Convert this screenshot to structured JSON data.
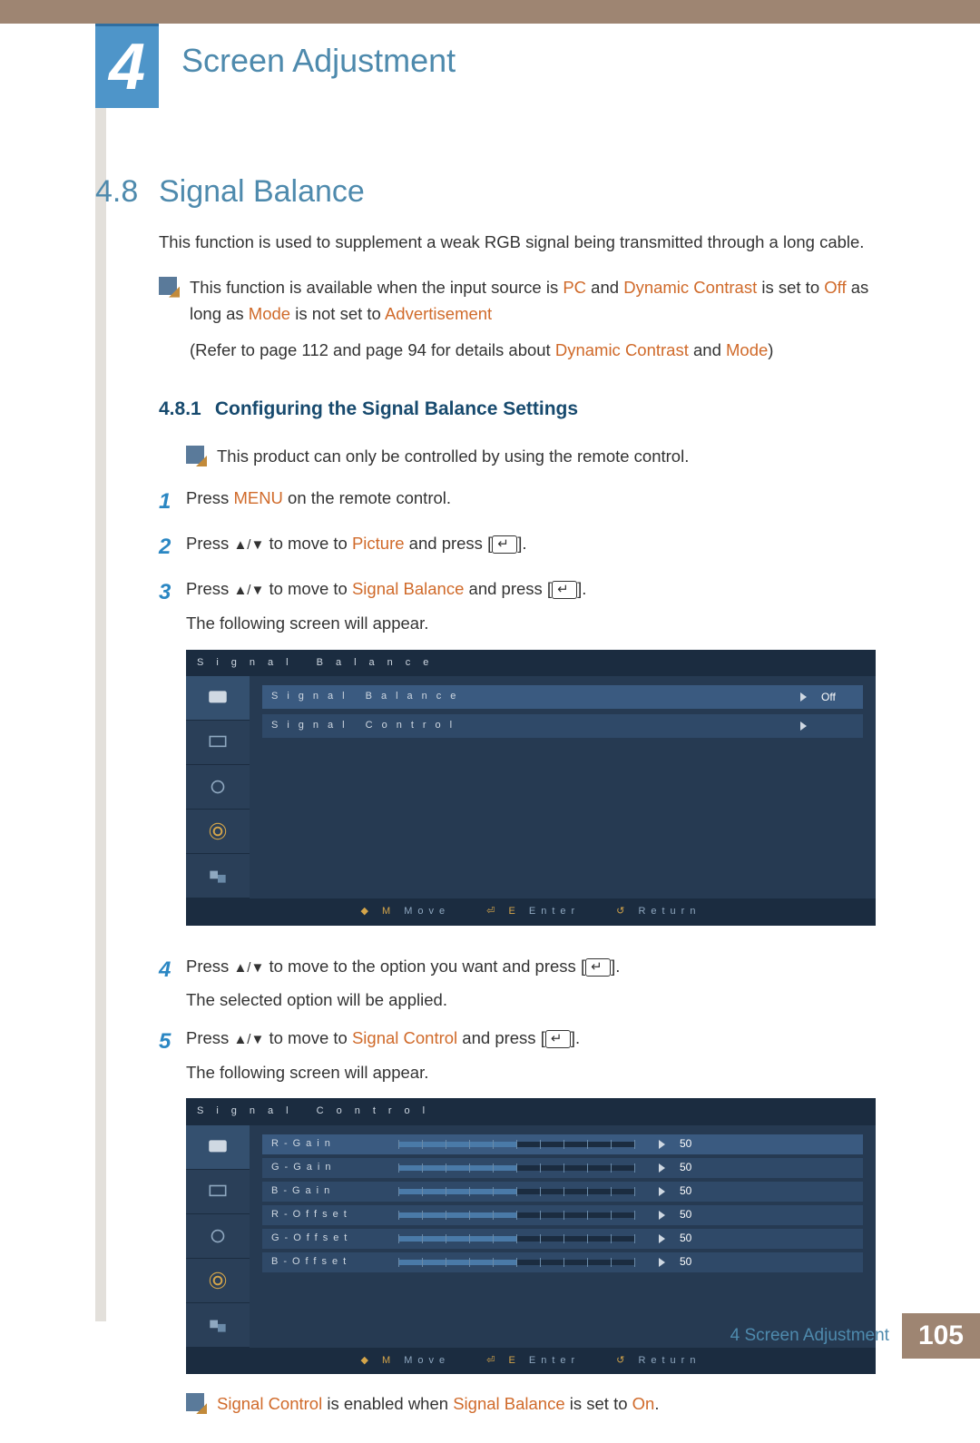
{
  "chapter": {
    "number": "4",
    "title": "Screen Adjustment"
  },
  "section": {
    "number": "4.8",
    "title": "Signal Balance"
  },
  "intro": "This function is used to supplement a weak RGB signal being transmitted through a long cable.",
  "note1": {
    "l1a": "This function is available when the input source is ",
    "l1b": "PC",
    "l1c": " and ",
    "l1d": "Dynamic Contrast",
    "l1e": " is set to ",
    "l1f": "Off",
    "l1g": " as long as ",
    "l2a": "Mode",
    "l2b": " is not set to ",
    "l2c": "Advertisement",
    "l3a": "(Refer to page 112 and page 94 for details about ",
    "l3b": "Dynamic Contrast",
    "l3c": " and ",
    "l3d": "Mode",
    "l3e": ")"
  },
  "subsection": {
    "number": "4.8.1",
    "title": "Configuring the Signal Balance Settings"
  },
  "note2": "This product can only be controlled by using the remote control.",
  "steps": {
    "1a": "Press ",
    "1b": "MENU",
    "1c": " on the remote control.",
    "2a": "Press ",
    "2b": " to move to ",
    "2c": "Picture",
    "2d": " and press [",
    "2e": "].",
    "3a": "Press ",
    "3b": " to move to ",
    "3c": "Signal Balance",
    "3d": " and press [",
    "3e": "].",
    "3f": "The following screen will appear.",
    "4a": "Press ",
    "4b": " to move to the option you want and press [",
    "4c": "].",
    "4d": "The selected option will be applied.",
    "5a": "Press ",
    "5b": " to move to ",
    "5c": "Signal Control",
    "5d": " and press [",
    "5e": "].",
    "5f": "The following screen will appear."
  },
  "osd1": {
    "title": "Signal Balance",
    "rows": [
      {
        "label": "Signal Balance",
        "value": "Off"
      },
      {
        "label": "Signal Control",
        "value": ""
      }
    ],
    "footer": {
      "move": "Move",
      "enter": "Enter",
      "return": "Return"
    }
  },
  "osd2": {
    "title": "Signal Control",
    "rows": [
      {
        "label": "R-Gain",
        "pct": 50,
        "value": "50"
      },
      {
        "label": "G-Gain",
        "pct": 50,
        "value": "50"
      },
      {
        "label": "B-Gain",
        "pct": 50,
        "value": "50"
      },
      {
        "label": "R-Offset",
        "pct": 50,
        "value": "50"
      },
      {
        "label": "G-Offset",
        "pct": 50,
        "value": "50"
      },
      {
        "label": "B-Offset",
        "pct": 50,
        "value": "50"
      }
    ],
    "footer": {
      "move": "Move",
      "enter": "Enter",
      "return": "Return"
    }
  },
  "note3": {
    "a": "Signal Control",
    "b": " is enabled when ",
    "c": "Signal Balance",
    "d": " is set to ",
    "e": "On",
    "f": "."
  },
  "footer": {
    "chapter": "4",
    "title": "Screen Adjustment",
    "page": "105"
  },
  "step_nums": {
    "1": "1",
    "2": "2",
    "3": "3",
    "4": "4",
    "5": "5"
  },
  "arrows": "▲/▼"
}
